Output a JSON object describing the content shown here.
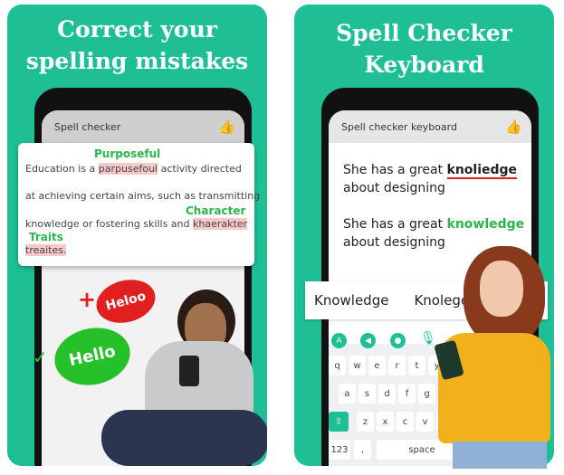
{
  "left": {
    "title_line1": "Correct your",
    "title_line2": "spelling mistakes",
    "app_title": "Spell checker",
    "text": {
      "line1_pre": "Education is a ",
      "line1_err": "parpusefoul",
      "line1_post": " activity directed",
      "line2": "at achieving certain aims, such as transmitting",
      "line3_pre": "knowledge or fostering skills and ",
      "line3_err": "khaerakter",
      "line4_err": "treaites."
    },
    "suggestions": [
      "Purposeful",
      "Character",
      "Traits"
    ],
    "bubbles": {
      "red": "Heloo",
      "green": "Hello"
    }
  },
  "right": {
    "title_line1": "Spell Checker",
    "title_line2": "Keyboard",
    "app_title": "Spell checker keyboard",
    "sentence1_pre": "She has a great ",
    "sentence1_err": "knoliedge",
    "sentence1_post": "about designing",
    "sentence2_pre": "She has a great ",
    "sentence2_fix": "knowledge",
    "sentence2_post": "about designing",
    "suggestions": [
      "Knowledge",
      "Knolege"
    ],
    "keys_row1": [
      "q",
      "w",
      "e",
      "r",
      "t",
      "y"
    ],
    "keys_row2": [
      "a",
      "s",
      "d",
      "f",
      "g"
    ],
    "keys_row3": [
      "z",
      "x",
      "c",
      "v",
      "b"
    ],
    "key_123": "123",
    "key_comma": ",",
    "key_space": "space"
  },
  "colors": {
    "brand": "#1fbf95",
    "error": "#f8c9c9",
    "suggestion": "#2bb54a",
    "bubble_red": "#e0201f"
  }
}
